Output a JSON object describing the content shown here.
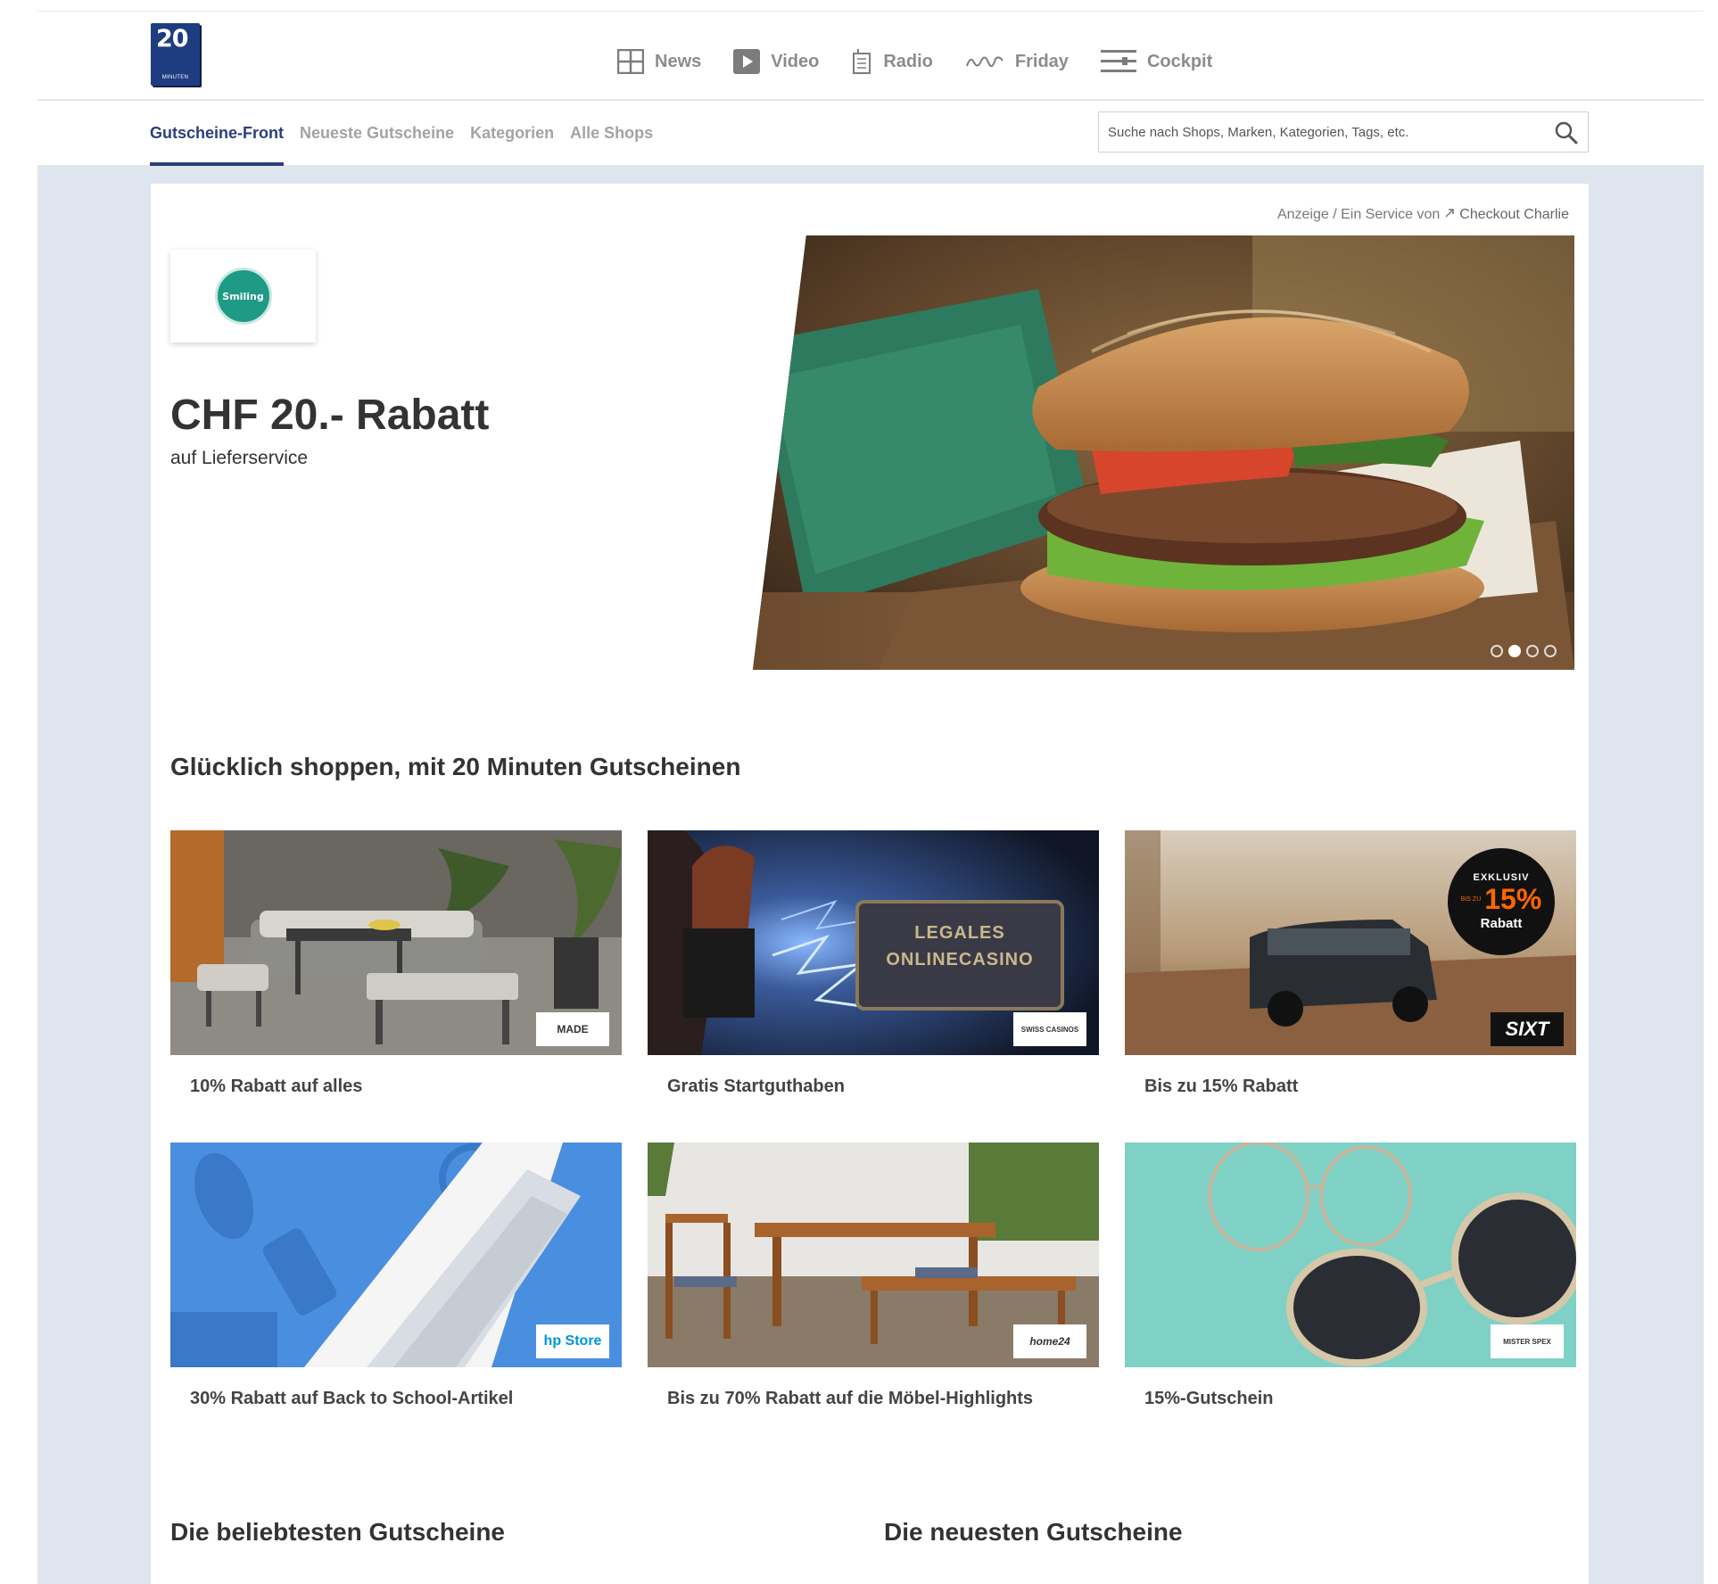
{
  "header": {
    "logo_number": "20",
    "logo_subtext": "MINUTEN",
    "nav": [
      {
        "label": "News",
        "icon": "grid-icon"
      },
      {
        "label": "Video",
        "icon": "play-icon"
      },
      {
        "label": "Radio",
        "icon": "radio-icon"
      },
      {
        "label": "Friday",
        "icon": "friday-icon"
      },
      {
        "label": "Cockpit",
        "icon": "menu-icon"
      }
    ]
  },
  "subnav": {
    "items": [
      "Gutscheine-Front",
      "Neueste Gutscheine",
      "Kategorien",
      "Alle Shops"
    ],
    "active": "Gutscheine-Front",
    "search_placeholder": "Suche nach Shops, Marken, Kategorien, Tags, etc."
  },
  "hero": {
    "sponsor_prefix": "Anzeige / Ein Service von",
    "sponsor_brand": "Checkout Charlie",
    "shop_logo_text": "Smiling",
    "title": "CHF 20.- Rabatt",
    "subtitle": "auf Lieferservice",
    "slides_count": 4,
    "active_slide": 2
  },
  "section": {
    "title": "Glücklich shoppen, mit 20 Minuten Gutscheinen"
  },
  "tiles": [
    {
      "label": "10% Rabatt auf alles",
      "logo": "MADE"
    },
    {
      "label": "Gratis Startguthaben",
      "logo": "SWISS CASINOS",
      "overlay": "LEGALES ONLINECASINO"
    },
    {
      "label": "Bis zu 15% Rabatt",
      "logo": "SIXT",
      "badge_top": "EXKLUSIV",
      "badge_value": "15%",
      "badge_prefix": "BIS ZU",
      "badge_bottom": "Rabatt"
    },
    {
      "label": "30% Rabatt auf Back to School-Artikel",
      "logo": "hp Store"
    },
    {
      "label": "Bis zu 70% Rabatt auf die Möbel-Highlights",
      "logo": "home24"
    },
    {
      "label": "15%-Gutschein",
      "logo": "MISTER SPEX"
    }
  ],
  "bottom": {
    "popular_title": "Die beliebtesten Gutscheine",
    "newest_title": "Die neuesten Gutscheine"
  },
  "colors": {
    "brand_navy": "#2a3f7b",
    "frame_bg": "#dfe5ee",
    "sixt_orange": "#ff6600",
    "hp_blue": "#0096d6"
  }
}
